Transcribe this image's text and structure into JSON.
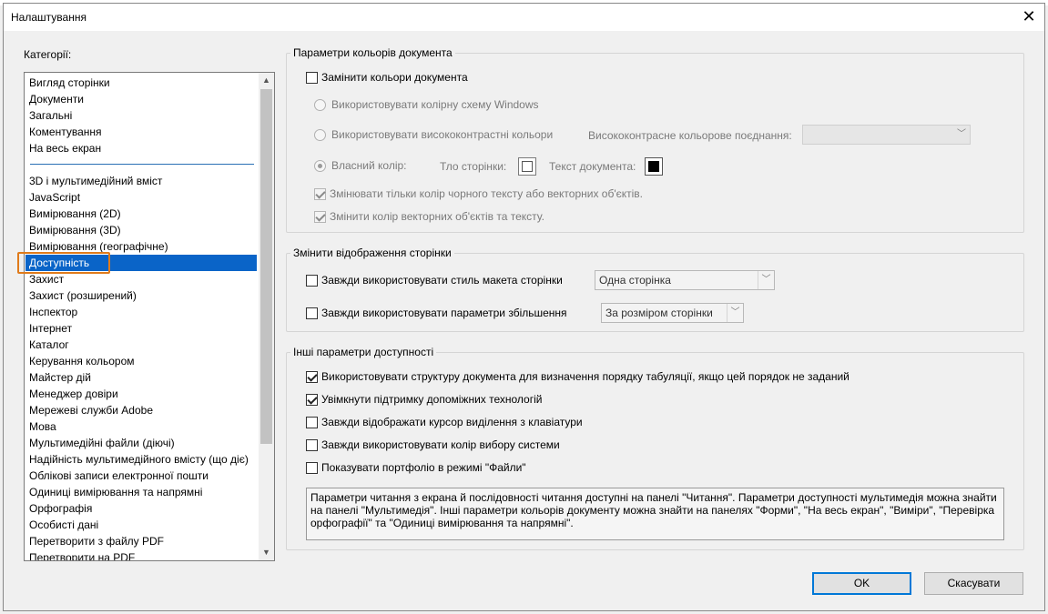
{
  "window": {
    "title": "Налаштування"
  },
  "categories": {
    "label": "Категорії:",
    "group1": [
      "Вигляд сторінки",
      "Документи",
      "Загальні",
      "Коментування",
      "На весь екран"
    ],
    "group2": [
      "3D і мультимедійний вміст",
      "JavaScript",
      "Вимірювання (2D)",
      "Вимірювання (3D)",
      "Вимірювання (географічне)",
      "Доступність",
      "Захист",
      "Захист (розширений)",
      "Інспектор",
      "Інтернет",
      "Каталог",
      "Керування кольором",
      "Майстер дій",
      "Менеджер довіри",
      "Мережеві служби Adobe",
      "Мова",
      "Мультимедійні файли (діючі)",
      "Надійність мультимедійного вмісту (що діє)",
      "Облікові записи електронної пошти",
      "Одиниці вимірювання та напрямні",
      "Орфографія",
      "Особисті дані",
      "Перетворити з файлу PDF",
      "Перетворити на PDF"
    ],
    "selected": "Доступність"
  },
  "doc_colors": {
    "title": "Параметри кольорів документа",
    "replace_label": "Замінити кольори документа",
    "radio_windows": "Використовувати колірну схему Windows",
    "radio_high_contrast": "Використовувати висококонтрастні кольори",
    "high_contrast_combo_label": "Висококонтрасне кольорове поєднання:",
    "radio_custom": "Власний колір:",
    "page_bg_label": "Тло сторінки:",
    "doc_text_label": "Текст документа:",
    "only_black_text": "Змінювати тільки колір чорного тексту або векторних об'єктів.",
    "change_vector": "Змінити колір векторних об'єктів та тексту.",
    "page_bg_color": "#ffffff",
    "doc_text_color": "#000000"
  },
  "page_display": {
    "title": "Змінити відображення сторінки",
    "layout_label": "Завжди використовувати стиль макета сторінки",
    "layout_value": "Одна сторінка",
    "zoom_label": "Завжди використовувати параметри збільшення",
    "zoom_value": "За розміром сторінки"
  },
  "other_accessibility": {
    "title": "Інші параметри доступності",
    "options": [
      "Використовувати структуру документа для визначення порядку табуляції, якщо цей порядок не заданий",
      "Увімкнути підтримку допоміжних технологій",
      "Завжди відображати курсор виділення з клавіатури",
      "Завжди використовувати колір вибору системи",
      "Показувати портфоліо в режимі \"Файли\""
    ],
    "info_text": "Параметри читання з екрана й послідовності читання доступні на панелі \"Читання\". Параметри доступності мультимедія можна знайти на панелі \"Мультимедія\". Інші параметри кольорів документу можна знайти на панелях \"Форми\", \"На весь екран\", \"Виміри\", \"Перевірка орфографії\" та \"Одиниці вимірювання та напрямні\"."
  },
  "buttons": {
    "ok": "OK",
    "cancel": "Скасувати"
  }
}
